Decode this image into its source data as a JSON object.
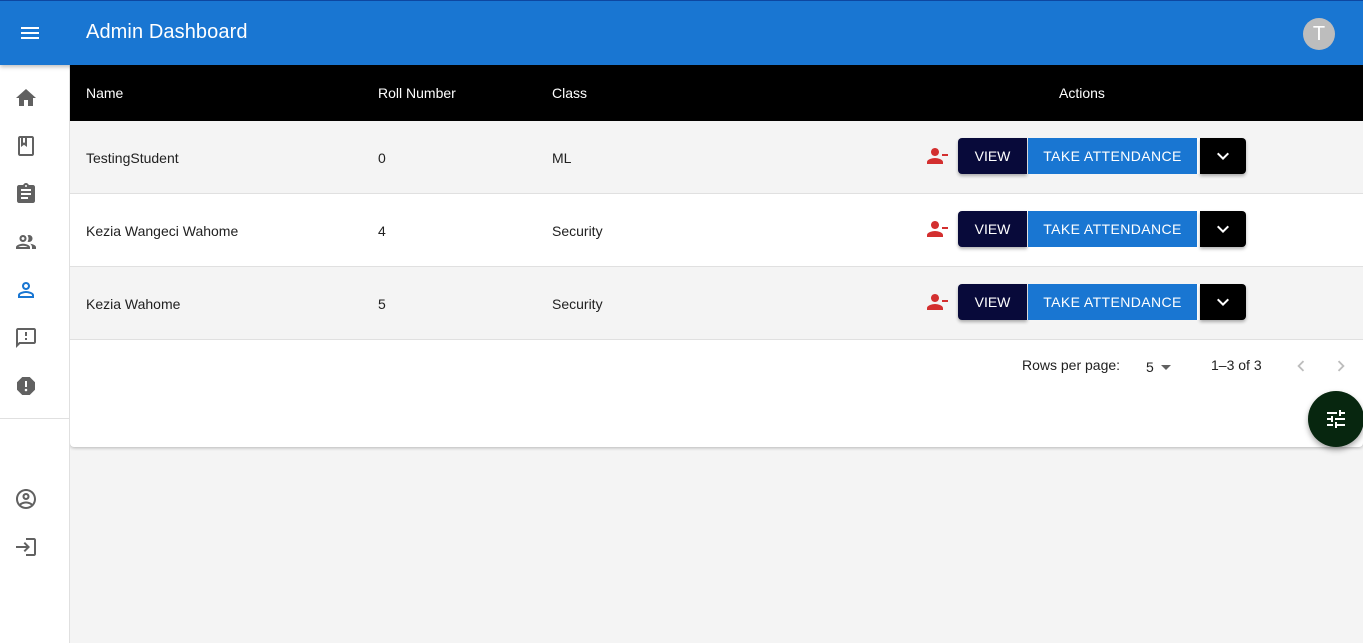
{
  "appbar": {
    "title": "Admin Dashboard",
    "avatar_initial": "T",
    "menu_icon": "menu-icon"
  },
  "sidebar": {
    "items": [
      {
        "icon": "home-icon"
      },
      {
        "icon": "book-icon"
      },
      {
        "icon": "clipboard-icon"
      },
      {
        "icon": "people-icon"
      },
      {
        "icon": "person-icon",
        "active": true
      },
      {
        "icon": "feedback-icon"
      },
      {
        "icon": "report-icon"
      }
    ],
    "bottom_items": [
      {
        "icon": "account-circle-icon"
      },
      {
        "icon": "login-icon"
      }
    ]
  },
  "table": {
    "headers": {
      "name": "Name",
      "roll": "Roll Number",
      "class": "Class",
      "actions": "Actions"
    },
    "rows": [
      {
        "name": "TestingStudent",
        "roll": "0",
        "class": "ML"
      },
      {
        "name": "Kezia Wangeci Wahome",
        "roll": "4",
        "class": "Security"
      },
      {
        "name": "Kezia Wahome",
        "roll": "5",
        "class": "Security"
      }
    ],
    "action_labels": {
      "view": "VIEW",
      "take": "TAKE ATTENDANCE"
    }
  },
  "pagination": {
    "rows_per_page_label": "Rows per page:",
    "rows_per_page": "5",
    "range": "1–3 of 3"
  },
  "colors": {
    "primary": "#1976d2",
    "view_button": "#080a3a",
    "remove_icon": "#d32f2f",
    "fab": "#07260f"
  }
}
